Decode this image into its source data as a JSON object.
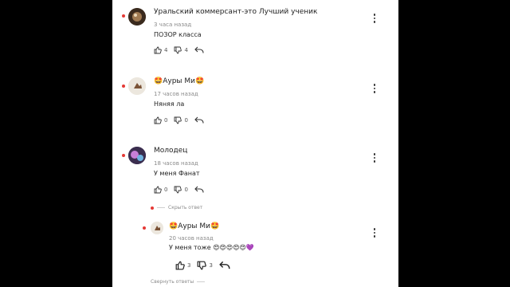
{
  "comments": [
    {
      "name": "Уральский коммерсант-это Лучший ученик",
      "time": "3 часа назад",
      "text": "ПОЗОР класса",
      "likes": "4",
      "dislikes": "4"
    },
    {
      "name": "🤩Ауры Ми🤩",
      "time": "17 часов назад",
      "text": "Няняя ла",
      "likes": "0",
      "dislikes": "0"
    },
    {
      "name": "Молодец",
      "time": "18 часов назад",
      "text": "У меня Фанат",
      "likes": "0",
      "dislikes": "0"
    }
  ],
  "replies_toggle": "Скрыть ответ",
  "reply": {
    "name": "🤩Ауры Ми🤩",
    "time": "20 часов назад",
    "text": "У меня тоже 😍😍😍😍😍💜",
    "likes": "3",
    "dislikes": "3"
  },
  "footer_link": "Свернуть ответы",
  "colors": {
    "accent_dot": "#e53935",
    "panel": "#ffffff",
    "backdrop": "#000000"
  },
  "icons": {
    "like": "thumb-up-icon",
    "dislike": "thumb-down-icon",
    "reply": "reply-arrow-icon",
    "menu": "more-vertical-icon"
  }
}
